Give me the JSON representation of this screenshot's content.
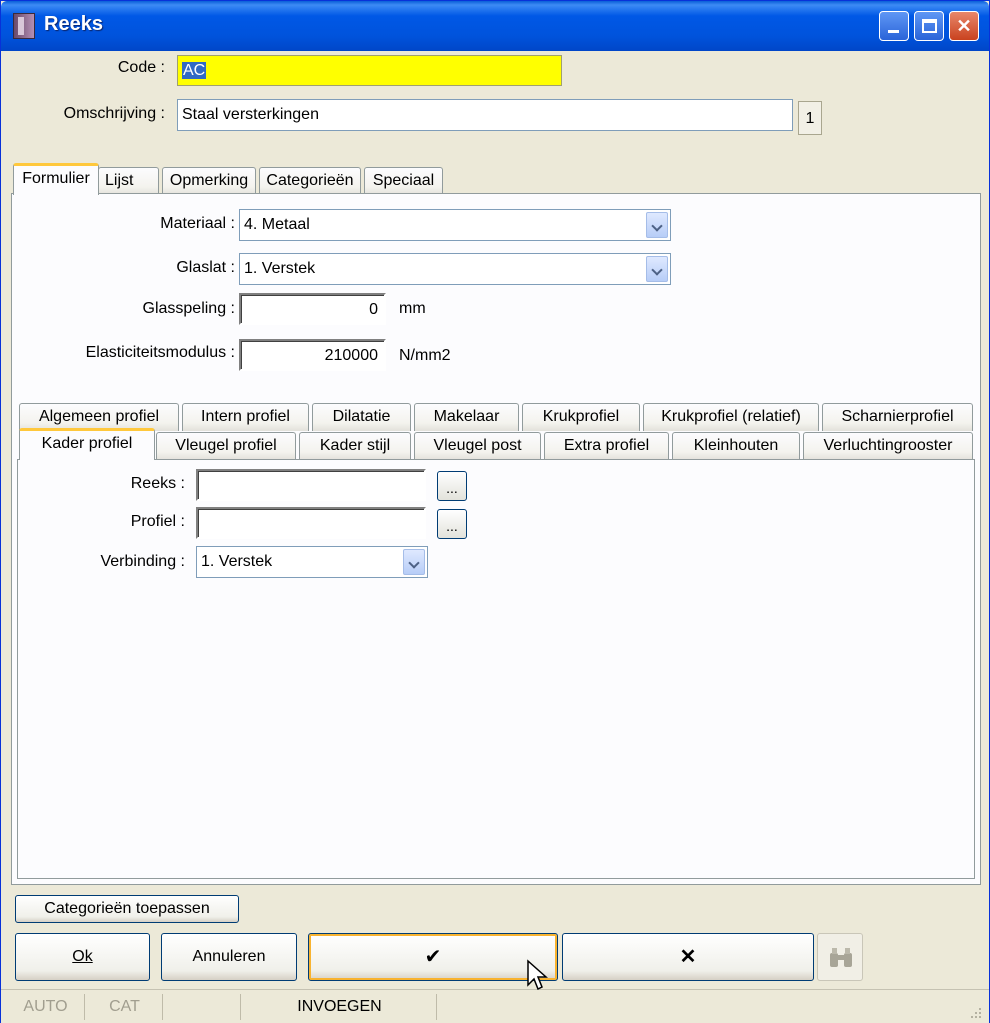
{
  "window": {
    "title": "Reeks"
  },
  "form": {
    "code_label": "Code :",
    "code_value": "AC",
    "omschrijving_label": "Omschrijving :",
    "omschrijving_value": "Staal versterkingen",
    "lang_badge": "1"
  },
  "main_tabs": [
    "Formulier",
    "Lijst",
    "Opmerking",
    "Categorieën",
    "Speciaal"
  ],
  "formulier": {
    "materiaal_label": "Materiaal :",
    "materiaal_value": "4.  Metaal",
    "glaslat_label": "Glaslat :",
    "glaslat_value": "1.  Verstek",
    "glasspeling_label": "Glasspeling :",
    "glasspeling_value": "0",
    "glasspeling_unit": "mm",
    "elasticiteit_label": "Elasticiteitsmodulus :",
    "elasticiteit_value": "210000",
    "elasticiteit_unit": "N/mm2"
  },
  "sub_tabs_row1": [
    "Algemeen profiel",
    "Intern profiel",
    "Dilatatie",
    "Makelaar",
    "Krukprofiel",
    "Krukprofiel (relatief)",
    "Scharnierprofiel"
  ],
  "sub_tabs_row2": [
    "Kader profiel",
    "Vleugel profiel",
    "Kader stijl",
    "Vleugel post",
    "Extra profiel",
    "Kleinhouten",
    "Verluchtingrooster"
  ],
  "kader": {
    "reeks_label": "Reeks :",
    "reeks_value": "",
    "profiel_label": "Profiel :",
    "profiel_value": "",
    "verbinding_label": "Verbinding :",
    "verbinding_value": "1.  Verstek",
    "browse_label": "..."
  },
  "buttons": {
    "categorieen_toepassen": "Categorieën toepassen",
    "ok": "Ok",
    "annuleren": "Annuleren",
    "confirm": "✔",
    "cancel": "✕"
  },
  "status": {
    "auto": "AUTO",
    "cat": "CAT",
    "mode": "INVOEGEN"
  },
  "colors": {
    "titlebar": "#0054E3",
    "code_highlight": "#FFFF00",
    "tab_active_accent": "#FFC83C"
  }
}
